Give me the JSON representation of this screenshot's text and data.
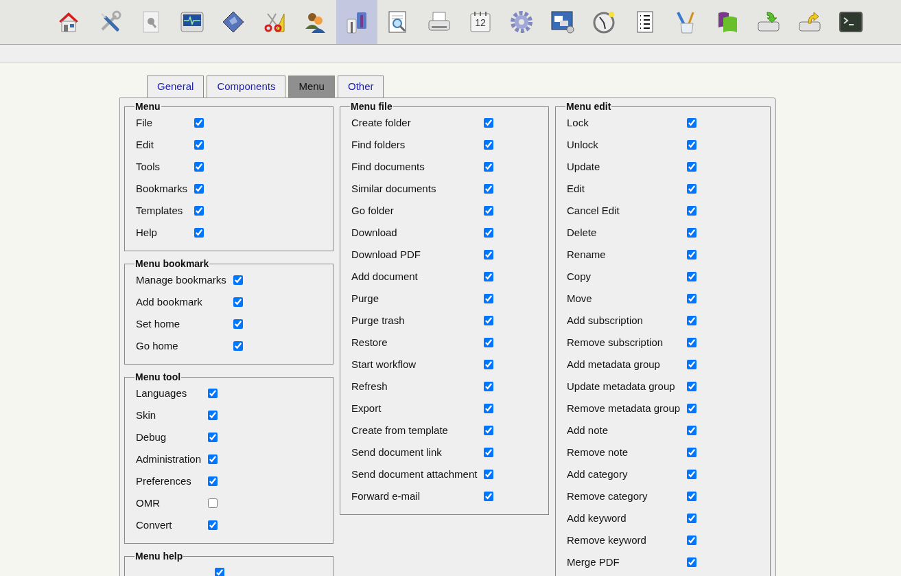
{
  "toolbar": [
    {
      "kind": "home",
      "selected": false
    },
    {
      "kind": "tools",
      "selected": false
    },
    {
      "kind": "page",
      "selected": false
    },
    {
      "kind": "monitor",
      "selected": false
    },
    {
      "kind": "diamond",
      "selected": false
    },
    {
      "kind": "scissors",
      "selected": false
    },
    {
      "kind": "users",
      "selected": false
    },
    {
      "kind": "shirts",
      "selected": true
    },
    {
      "kind": "search",
      "selected": false
    },
    {
      "kind": "printer",
      "selected": false
    },
    {
      "kind": "calendar",
      "label": "12",
      "selected": false
    },
    {
      "kind": "gear",
      "selected": false
    },
    {
      "kind": "windows",
      "selected": false
    },
    {
      "kind": "clock",
      "selected": false
    },
    {
      "kind": "list",
      "selected": false
    },
    {
      "kind": "pens",
      "selected": false
    },
    {
      "kind": "panels",
      "selected": false
    },
    {
      "kind": "drive-in",
      "selected": false
    },
    {
      "kind": "drive-out",
      "selected": false
    },
    {
      "kind": "terminal",
      "selected": false
    }
  ],
  "tabs": [
    {
      "label": "General",
      "selected": false
    },
    {
      "label": "Components",
      "selected": false
    },
    {
      "label": "Menu",
      "selected": true
    },
    {
      "label": "Other",
      "selected": false
    }
  ],
  "columns": [
    {
      "groups": [
        {
          "legend": "Menu",
          "items": [
            {
              "label": "File",
              "checked": true
            },
            {
              "label": "Edit",
              "checked": true
            },
            {
              "label": "Tools",
              "checked": true
            },
            {
              "label": "Bookmarks",
              "checked": true
            },
            {
              "label": "Templates",
              "checked": true
            },
            {
              "label": "Help",
              "checked": true
            }
          ]
        },
        {
          "legend": "Menu bookmark",
          "items": [
            {
              "label": "Manage bookmarks",
              "checked": true
            },
            {
              "label": "Add bookmark",
              "checked": true
            },
            {
              "label": "Set home",
              "checked": true
            },
            {
              "label": "Go home",
              "checked": true
            }
          ]
        },
        {
          "legend": "Menu tool",
          "items": [
            {
              "label": "Languages",
              "checked": true
            },
            {
              "label": "Skin",
              "checked": true
            },
            {
              "label": "Debug",
              "checked": true
            },
            {
              "label": "Administration",
              "checked": true
            },
            {
              "label": "Preferences",
              "checked": true
            },
            {
              "label": "OMR",
              "checked": false
            },
            {
              "label": "Convert",
              "checked": true
            }
          ]
        },
        {
          "legend": "Menu help",
          "items": [
            {
              "checked": true
            }
          ]
        }
      ]
    },
    {
      "groups": [
        {
          "legend": "Menu file",
          "items": [
            {
              "label": "Create folder",
              "checked": true
            },
            {
              "label": "Find folders",
              "checked": true
            },
            {
              "label": "Find documents",
              "checked": true
            },
            {
              "label": "Similar documents",
              "checked": true
            },
            {
              "label": "Go folder",
              "checked": true
            },
            {
              "label": "Download",
              "checked": true
            },
            {
              "label": "Download PDF",
              "checked": true
            },
            {
              "label": "Add document",
              "checked": true
            },
            {
              "label": "Purge",
              "checked": true
            },
            {
              "label": "Purge trash",
              "checked": true
            },
            {
              "label": "Restore",
              "checked": true
            },
            {
              "label": "Start workflow",
              "checked": true
            },
            {
              "label": "Refresh",
              "checked": true
            },
            {
              "label": "Export",
              "checked": true
            },
            {
              "label": "Create from template",
              "checked": true
            },
            {
              "label": "Send document link",
              "checked": true
            },
            {
              "label": "Send document attachment",
              "checked": true
            },
            {
              "label": "Forward e-mail",
              "checked": true
            }
          ]
        }
      ]
    },
    {
      "groups": [
        {
          "legend": "Menu edit",
          "items": [
            {
              "label": "Lock",
              "checked": true
            },
            {
              "label": "Unlock",
              "checked": true
            },
            {
              "label": "Update",
              "checked": true
            },
            {
              "label": "Edit",
              "checked": true
            },
            {
              "label": "Cancel Edit",
              "checked": true
            },
            {
              "label": "Delete",
              "checked": true
            },
            {
              "label": "Rename",
              "checked": true
            },
            {
              "label": "Copy",
              "checked": true
            },
            {
              "label": "Move",
              "checked": true
            },
            {
              "label": "Add subscription",
              "checked": true
            },
            {
              "label": "Remove subscription",
              "checked": true
            },
            {
              "label": "Add metadata group",
              "checked": true
            },
            {
              "label": "Update metadata group",
              "checked": true
            },
            {
              "label": "Remove metadata group",
              "checked": true
            },
            {
              "label": "Add note",
              "checked": true
            },
            {
              "label": "Remove note",
              "checked": true
            },
            {
              "label": "Add category",
              "checked": true
            },
            {
              "label": "Remove category",
              "checked": true
            },
            {
              "label": "Add keyword",
              "checked": true
            },
            {
              "label": "Remove keyword",
              "checked": true
            },
            {
              "label": "Merge PDF",
              "checked": true
            }
          ]
        }
      ]
    }
  ]
}
